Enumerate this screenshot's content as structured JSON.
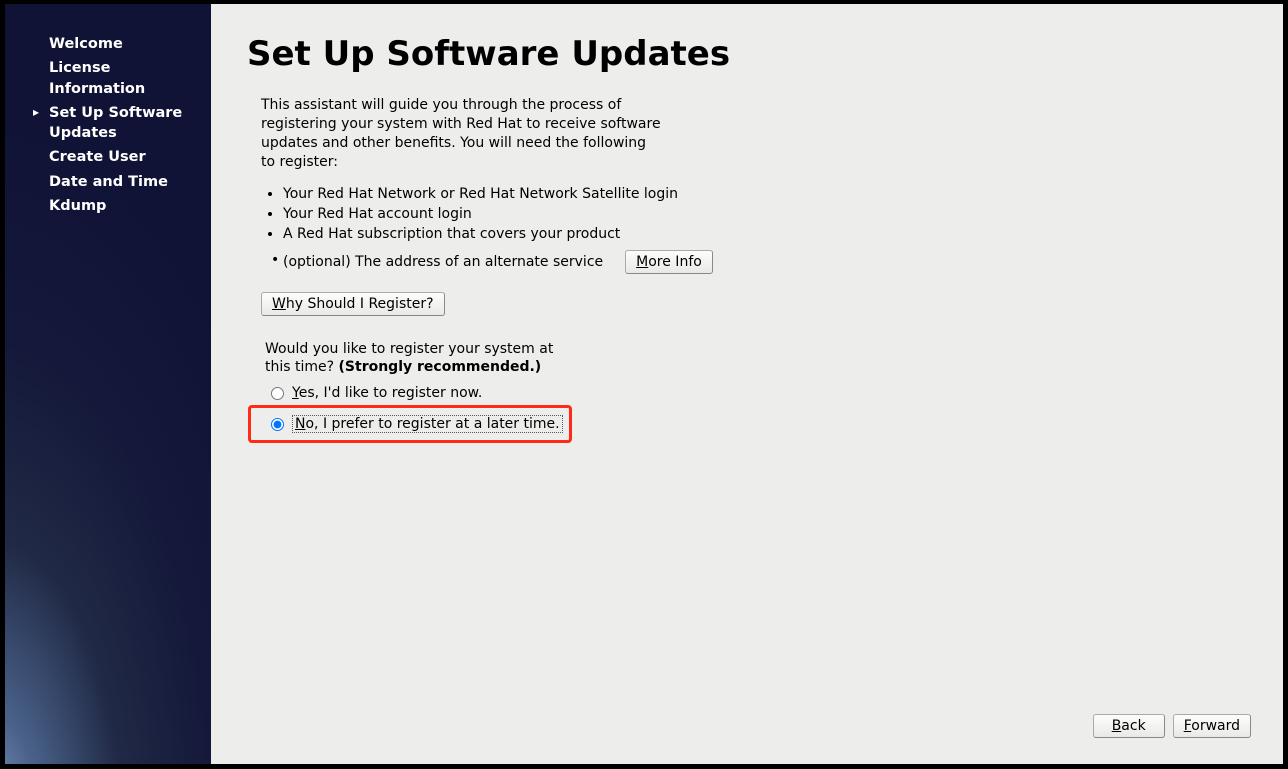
{
  "sidebar": {
    "items": [
      {
        "label": "Welcome",
        "active": false
      },
      {
        "label": "License Information",
        "active": false
      },
      {
        "label": "Set Up Software Updates",
        "active": true
      },
      {
        "label": "Create User",
        "active": false
      },
      {
        "label": "Date and Time",
        "active": false
      },
      {
        "label": "Kdump",
        "active": false
      }
    ]
  },
  "page": {
    "title": "Set Up Software Updates",
    "intro": "This assistant will guide you through the process of registering your system with Red Hat to receive software updates and other benefits. You will need the following to register:",
    "requirements": [
      "Your Red Hat Network or Red Hat Network Satellite login",
      "Your Red Hat account login",
      "A Red Hat subscription that covers your product"
    ],
    "optional_text": "(optional) The address of an alternate service",
    "more_info_label": "More Info",
    "why_label": "Why Should I Register?",
    "question_text": "Would you like to register your system at this time? ",
    "question_strong": "(Strongly recommended.)",
    "radio_yes": "Yes, I'd like to register now.",
    "radio_no": "No, I prefer to register at a later time.",
    "selected": "no"
  },
  "footer": {
    "back_label": "Back",
    "forward_label": "Forward"
  }
}
